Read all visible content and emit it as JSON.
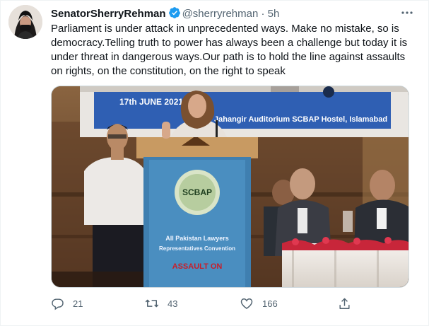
{
  "tweet": {
    "display_name": "SenatorSherryRehman",
    "handle": "@sherryrehman",
    "separator": "·",
    "time": "5h",
    "text": "Parliament is under attack in unprecedented ways. Make no mistake, so is democracy.Telling truth to power has always been a challenge but today it is under threat in dangerous ways.Our path is to hold the line against assaults on rights, on the constitution, on the right to speak"
  },
  "media": {
    "banner_date": "17th JUNE 2021 at",
    "banner_venue": "Jahangir Auditorium SCBAP Hostel, Islamabad",
    "podium_logo": "SCBAP",
    "podium_line1": "All Pakistan Lawyers",
    "podium_line2": "Representatives Convention",
    "podium_line3": "ASSAULT ON"
  },
  "actions": {
    "reply_count": "21",
    "retweet_count": "43",
    "like_count": "166"
  },
  "colors": {
    "verified_blue": "#1d9bf0",
    "secondary_text": "#536471",
    "banner_blue": "#2f5fb3"
  },
  "icons": [
    "verified-badge-icon",
    "more-options-icon",
    "reply-icon",
    "retweet-icon",
    "like-icon",
    "share-icon"
  ]
}
